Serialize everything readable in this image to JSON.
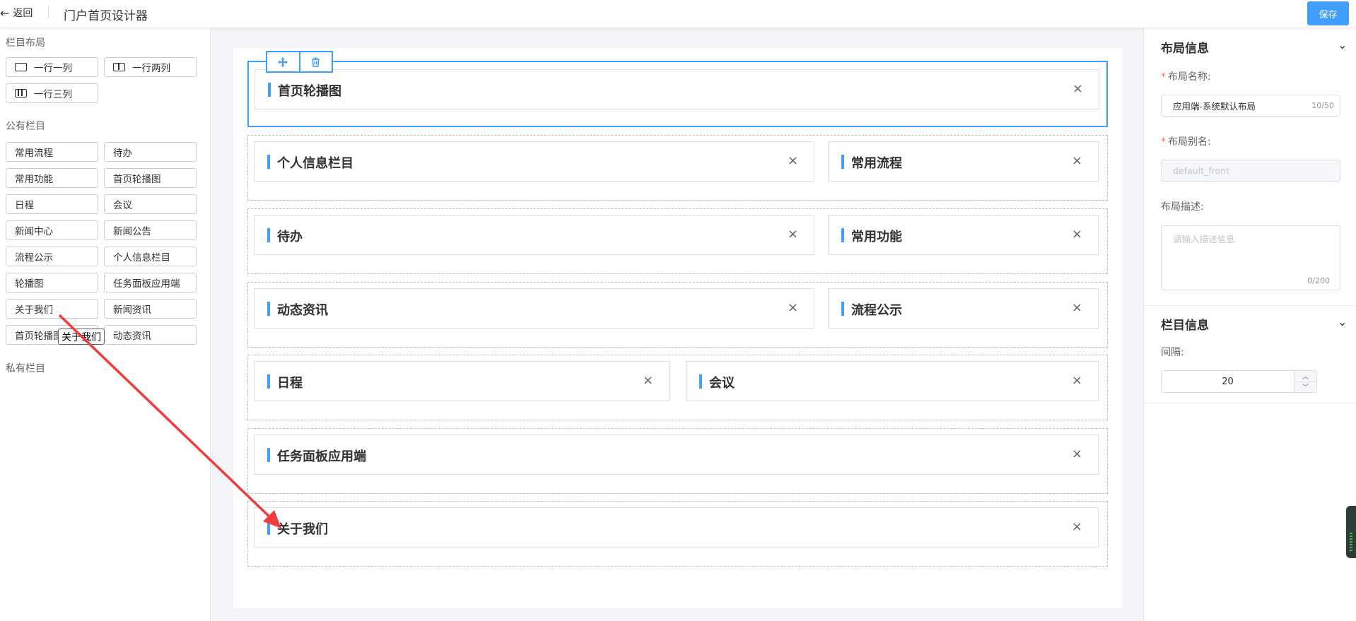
{
  "header": {
    "back_label": "返回",
    "title": "门户首页设计器",
    "save_label": "保存"
  },
  "left": {
    "layout_section": "栏目布局",
    "layouts": [
      "一行一列",
      "一行两列",
      "一行三列"
    ],
    "public_section": "公有栏目",
    "public_items": [
      "常用流程",
      "待办",
      "常用功能",
      "首页轮播图",
      "日程",
      "会议",
      "新闻中心",
      "新闻公告",
      "流程公示",
      "个人信息栏目",
      "轮播图",
      "任务面板应用端",
      "关于我们",
      "新闻资讯",
      "首页轮播图",
      "动态资讯"
    ],
    "drag_tooltip": "关于我们",
    "private_section": "私有栏目"
  },
  "canvas": {
    "rows": [
      [
        "首页轮播图"
      ],
      [
        "个人信息栏目",
        "常用流程"
      ],
      [
        "待办",
        "常用功能"
      ],
      [
        "动态资讯",
        "流程公示"
      ],
      [
        "日程",
        "会议"
      ],
      [
        "任务面板应用端"
      ],
      [
        "关于我们"
      ]
    ],
    "close_symbol": "×"
  },
  "right": {
    "layout_info_title": "布局信息",
    "name_label": "布局名称:",
    "name_value": "应用端-系统默认布局",
    "name_count": "10/50",
    "alias_label": "布局别名:",
    "alias_placeholder": "default_front",
    "desc_label": "布局描述:",
    "desc_placeholder": "请输入描述信息",
    "desc_count": "0/200",
    "column_info_title": "栏目信息",
    "gap_label": "间隔:",
    "gap_value": "20"
  },
  "icons": {
    "back": "arrow-left-icon",
    "move": "move-icon",
    "delete": "trash-icon",
    "collapse": "chevron-down-icon"
  },
  "colors": {
    "primary": "#409eff",
    "required": "#f56c6c",
    "annotation_arrow": "#f03c3c"
  }
}
